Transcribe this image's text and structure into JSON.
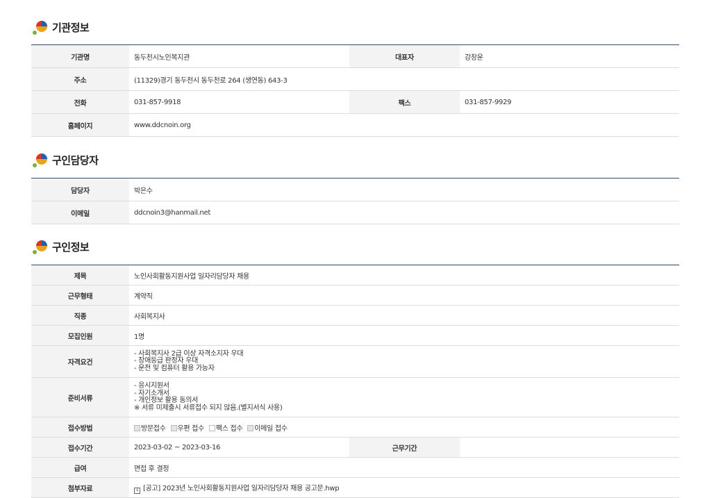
{
  "sections": {
    "org": {
      "title": "기관정보",
      "name_label": "기관명",
      "name": "동두천시노인복지관",
      "rep_label": "대표자",
      "rep": "강창운",
      "addr_label": "주소",
      "addr": "(11329)경기 동두천시 동두천로 264 (생연동) 643-3",
      "tel_label": "전화",
      "tel": "031-857-9918",
      "fax_label": "팩스",
      "fax": "031-857-9929",
      "home_label": "홈페이지",
      "home": "www.ddcnoin.org"
    },
    "contact": {
      "title": "구인담당자",
      "person_label": "담당자",
      "person": "박은수",
      "email_label": "이메일",
      "email": "ddcnoin3@hanmail.net"
    },
    "job": {
      "title": "구인정보",
      "subject_label": "제목",
      "subject": "노인사회활동지원사업 일자리담당자 채용",
      "type_label": "근무형태",
      "type": "계약직",
      "occ_label": "직종",
      "occ": "사회복지사",
      "count_label": "모집인원",
      "count": "1명",
      "qual_label": "자격요건",
      "qual": [
        "- 사회복지사 2급 이상 자격소지자 우대",
        "- 장애등급 판정자 우대",
        "- 운전 및 컴퓨터 활용 가능자"
      ],
      "docs_label": "준비서류",
      "docs": [
        "- 응시지원서",
        "- 자기소개서",
        "- 개인정보 활용 동의서",
        "※ 서류 미제출시 서류접수 되지 않음.(별지서식 사용)"
      ],
      "method_label": "접수방법",
      "methods": [
        {
          "label": "방문접수",
          "checked": true
        },
        {
          "label": "우편 접수",
          "checked": true
        },
        {
          "label": "팩스 접수",
          "checked": false
        },
        {
          "label": "이메일 접수",
          "checked": true
        }
      ],
      "period_label": "접수기간",
      "period": "2023-03-02 ~ 2023-03-16",
      "work_period_label": "근무기간",
      "work_period": "",
      "salary_label": "급여",
      "salary": "면접 후 결정",
      "attach_label": "첨부자료",
      "attach": "[공고] 2023년 노인사회활동지원사업 일자리담당자 채용 공고문.hwp"
    }
  }
}
